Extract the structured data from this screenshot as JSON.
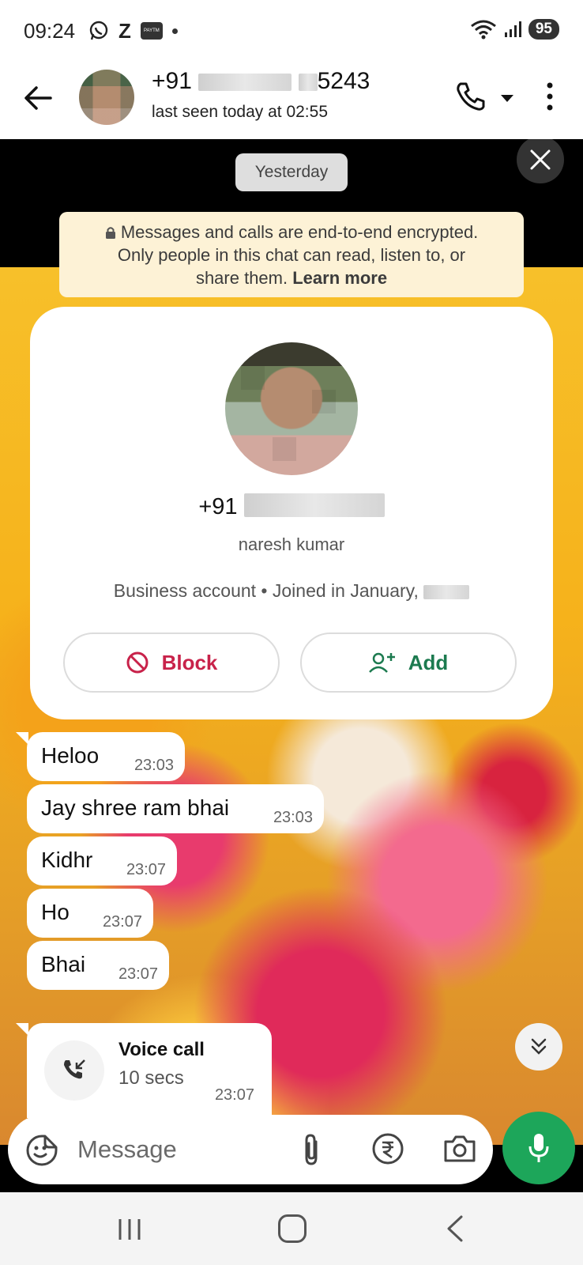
{
  "status_bar": {
    "time": "09:24",
    "left_icons": [
      "whatsapp-icon",
      "z-icon",
      "paytm-icon",
      "dot"
    ],
    "z_label": "Z",
    "paytm_label": "PAYTM",
    "battery": "95"
  },
  "header": {
    "name_prefix": "+91",
    "name_suffix": "5243",
    "status": "last seen today at 02:55"
  },
  "chat": {
    "date_chip": "Yesterday",
    "encryption_line1": "Messages and calls are end-to-end encrypted.",
    "encryption_line2": "Only people in this chat can read, listen to, or",
    "encryption_line3_prefix": "share them.",
    "encryption_learn_more": "Learn more",
    "colors": {
      "wallpaper_top": "#000000",
      "encryption_bg": "#fdf2d6",
      "block_red": "#c8224a",
      "add_green": "#1c7a4f",
      "mic_green": "#1da65a"
    }
  },
  "contact_card": {
    "phone_prefix": "+91",
    "name": "naresh kumar",
    "business_info": "Business account • Joined in January,",
    "block_label": "Block",
    "add_label": "Add"
  },
  "messages": [
    {
      "text": "Heloo",
      "time": "23:03"
    },
    {
      "text": "Jay shree ram bhai",
      "time": "23:03"
    },
    {
      "text": "Kidhr",
      "time": "23:07"
    },
    {
      "text": "Ho",
      "time": "23:07"
    },
    {
      "text": "Bhai",
      "time": "23:07"
    }
  ],
  "voice_call": {
    "title": "Voice call",
    "duration": "10 secs",
    "time": "23:07"
  },
  "composer": {
    "placeholder": "Message"
  }
}
